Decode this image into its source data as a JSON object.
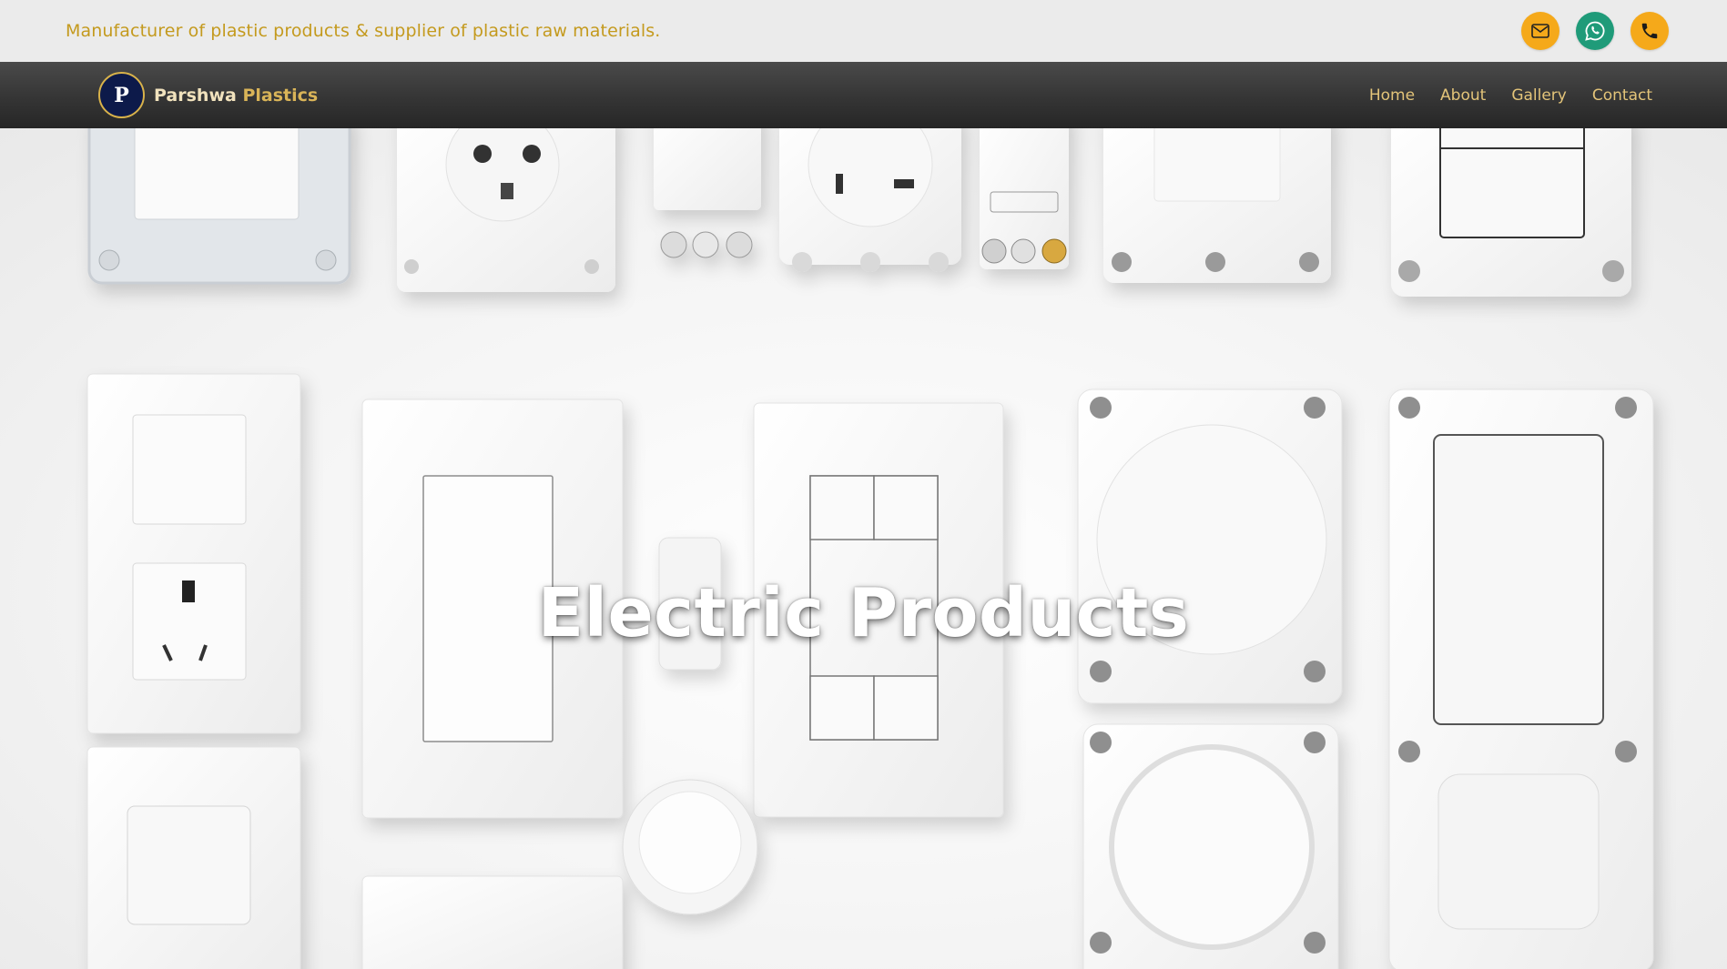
{
  "topbar": {
    "tagline": "Manufacturer of plastic products & supplier of plastic raw materials.",
    "icons": [
      "mail-icon",
      "whatsapp-icon",
      "phone-icon"
    ]
  },
  "navbar": {
    "logo_letter": "P",
    "brand_part1": "Parshwa",
    "brand_part2": "Plastics",
    "links": [
      "Home",
      "About",
      "Gallery",
      "Contact"
    ]
  },
  "hero": {
    "title": "Electric Products"
  },
  "colors": {
    "accent_gold": "#c49a1e",
    "mail_bg": "#f5a91a",
    "whatsapp_bg": "#1f9b79",
    "phone_bg": "#f5a91a",
    "nav_bg": "#353535",
    "nav_link": "#e3c479"
  }
}
